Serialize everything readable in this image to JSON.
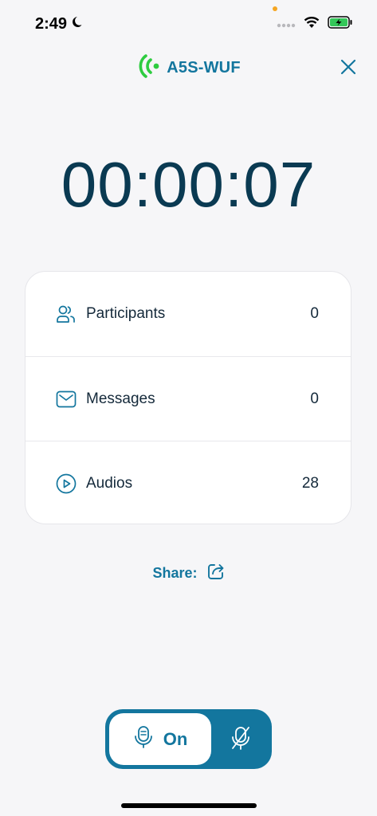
{
  "status_bar": {
    "time": "2:49"
  },
  "header": {
    "brand_name": "A5S-WUF"
  },
  "timer": {
    "value": "00:00:07"
  },
  "stats": [
    {
      "label": "Participants",
      "count": "0",
      "icon": "participants-icon"
    },
    {
      "label": "Messages",
      "count": "0",
      "icon": "envelope-icon"
    },
    {
      "label": "Audios",
      "count": "28",
      "icon": "play-circle-icon"
    }
  ],
  "share": {
    "label": "Share:"
  },
  "mic_toggle": {
    "on_label": "On"
  },
  "colors": {
    "accent": "#13769e",
    "timer": "#0a3a52",
    "brand_icon": "#2ecc40",
    "background": "#f6f6f8"
  }
}
